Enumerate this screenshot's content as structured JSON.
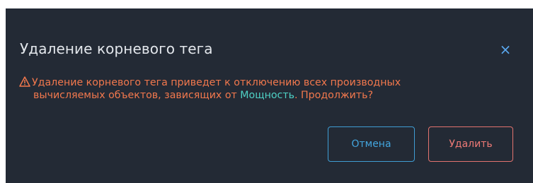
{
  "dialog": {
    "title": "Удаление корневого тега",
    "close_glyph": "×",
    "message": {
      "prefix": "Удаление корневого тега приведет к отключению всех производных",
      "line2_prefix": "вычисляемых объектов, зависящих от ",
      "highlight": "Мощность",
      "suffix": ". Продолжить?"
    },
    "buttons": {
      "cancel_label": "Отмена",
      "delete_label": "Удалить"
    }
  },
  "icons": {
    "warning": "warning-triangle-icon",
    "close": "close-icon"
  },
  "colors": {
    "background": "#232a35",
    "title": "#e3e7ec",
    "warning_text": "#f2784d",
    "highlight": "#4fd1c5",
    "cancel_accent": "#3f9dd4",
    "delete_accent": "#e3736f",
    "close_icon": "#5aa8f0"
  }
}
